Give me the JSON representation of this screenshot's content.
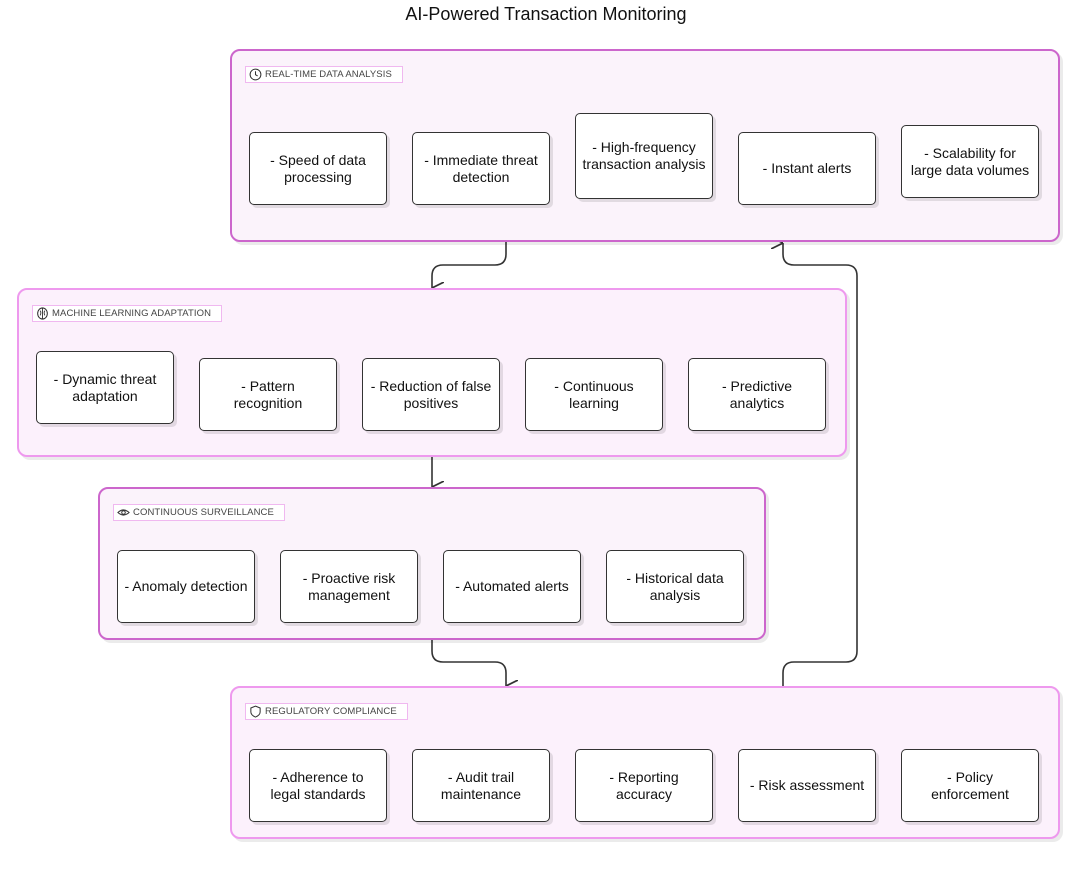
{
  "title": "AI-Powered Transaction Monitoring",
  "colors": {
    "group_border_primary": "#cc66cc",
    "group_border_secondary": "#ee99ee",
    "group_fill": "#fbf3fb",
    "node_border": "#333333",
    "edge": "#333333"
  },
  "groups": [
    {
      "id": "realtime",
      "label": "REAL-TIME DATA ANALYSIS",
      "icon": "clock-icon",
      "items": [
        "- Speed of data processing",
        "- Immediate threat detection",
        "- High-frequency transaction analysis",
        "- Instant alerts",
        "- Scalability for large data volumes"
      ]
    },
    {
      "id": "ml",
      "label": "MACHINE LEARNING ADAPTATION",
      "icon": "brain-icon",
      "items": [
        "- Dynamic threat adaptation",
        "- Pattern recognition",
        "- Reduction of false positives",
        "- Continuous learning",
        "- Predictive analytics"
      ]
    },
    {
      "id": "surveillance",
      "label": "CONTINUOUS SURVEILLANCE",
      "icon": "eye-icon",
      "items": [
        "- Anomaly detection",
        "- Proactive risk management",
        "- Automated alerts",
        "- Historical data analysis"
      ]
    },
    {
      "id": "compliance",
      "label": "REGULATORY COMPLIANCE",
      "icon": "shield-icon",
      "items": [
        "- Adherence to legal standards",
        "- Audit trail maintenance",
        "- Reporting accuracy",
        "- Risk assessment",
        "- Policy enforcement"
      ]
    }
  ],
  "edges": [
    {
      "from": "realtime",
      "to": "ml"
    },
    {
      "from": "ml",
      "to": "surveillance"
    },
    {
      "from": "surveillance",
      "to": "compliance"
    },
    {
      "from": "compliance",
      "to": "realtime"
    }
  ]
}
